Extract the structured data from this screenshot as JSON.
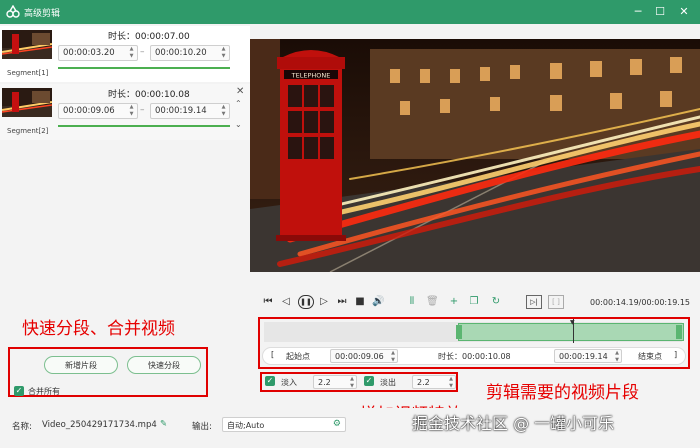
{
  "titlebar": {
    "title": "高级剪辑",
    "min": "─",
    "max": "☐",
    "close": "✕"
  },
  "segments": [
    {
      "label": "Segment[1]",
      "duration": "时长：00:00:07.00",
      "start": "00:00:03.20",
      "end": "00:00:10.20"
    },
    {
      "label": "Segment[2]",
      "duration": "时长：00:00:10.08",
      "start": "00:00:09.06",
      "end": "00:00:19.14"
    }
  ],
  "left_actions": {
    "add_segment": "新增片段",
    "quick_split": "快速分段",
    "merge_all": "合并所有",
    "annotation": "快速分段、合并视频"
  },
  "player": {
    "time_display": "00:00:14.19/00:00:19.15",
    "booth_sign": "TELEPHONE"
  },
  "trim": {
    "start_label": "起始点",
    "start_value": "00:00:09.06",
    "duration_label": "时长：00:00:10.08",
    "end_value": "00:00:19.14",
    "end_label": "结束点",
    "annotation": "剪辑需要的视频片段"
  },
  "effects": {
    "fade_in_label": "淡入",
    "fade_in_value": "2.2",
    "fade_out_label": "淡出",
    "fade_out_value": "2.2",
    "annotation": "增加视频特效"
  },
  "footer": {
    "name_label": "名称:",
    "file_name": "Video_250429171734.mp4",
    "output_label": "输出:",
    "output_value": "自动;Auto",
    "watermark": "掘金技术社区 @ 一罐小可乐"
  },
  "colors": {
    "accent": "#2f9a6a",
    "annotation_red": "#e60000",
    "selection_green": "#a9d8b4"
  }
}
